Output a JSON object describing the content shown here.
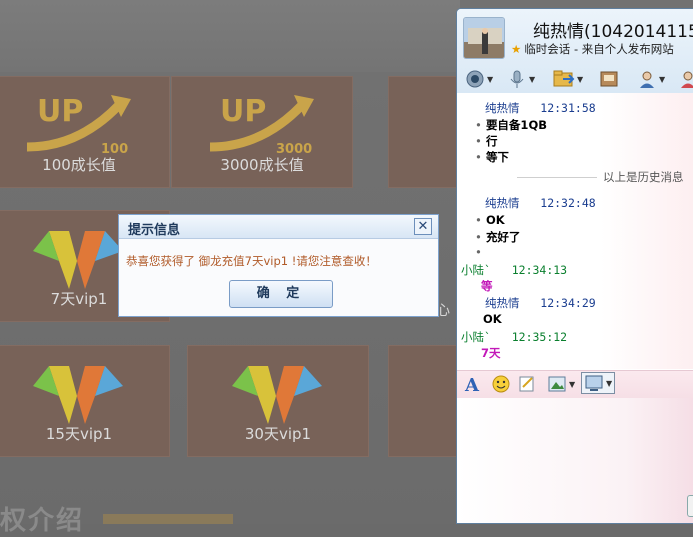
{
  "background_page": {
    "cards": [
      {
        "label": "100成长值",
        "art_text": "UP",
        "art_number": "100"
      },
      {
        "label": "3000成长值",
        "art_text": "UP",
        "art_number": "3000"
      },
      {
        "label": "7天vip1"
      },
      {
        "label": "15天vip1"
      },
      {
        "label": "30天vip1"
      }
    ],
    "side_char": "心",
    "footer_title": "权介绍"
  },
  "dialog": {
    "title": "提示信息",
    "close_symbol": "✕",
    "message": "恭喜您获得了 御龙充值7天vip1 !请您注意查收！",
    "ok_label": "确 定"
  },
  "chat_window": {
    "contact_name": "纯热情(1042014115",
    "subtitle": "临时会话 - 来自个人发布网站",
    "history_separator": "以上是历史消息",
    "messages": [
      {
        "sender": "纯热情",
        "time": "12:31:58",
        "lines": [
          "要自备1QB",
          "行",
          "等下"
        ]
      },
      {
        "sender": "纯热情",
        "time": "12:32:48",
        "lines": [
          "OK",
          "充好了",
          ""
        ]
      },
      {
        "sender": "小陆`",
        "time": "12:34:13",
        "lines": [
          "等"
        ]
      },
      {
        "sender": "纯热情",
        "time": "12:34:29",
        "lines": [
          "OK"
        ]
      },
      {
        "sender": "小陆`",
        "time": "12:35:12",
        "lines": [
          "7天"
        ]
      }
    ]
  },
  "colors": {
    "dialog_message": "#b05a28",
    "self_sender": "#0a7f2e",
    "self_message": "#c218b8",
    "other_sender": "#1a3d8f"
  }
}
